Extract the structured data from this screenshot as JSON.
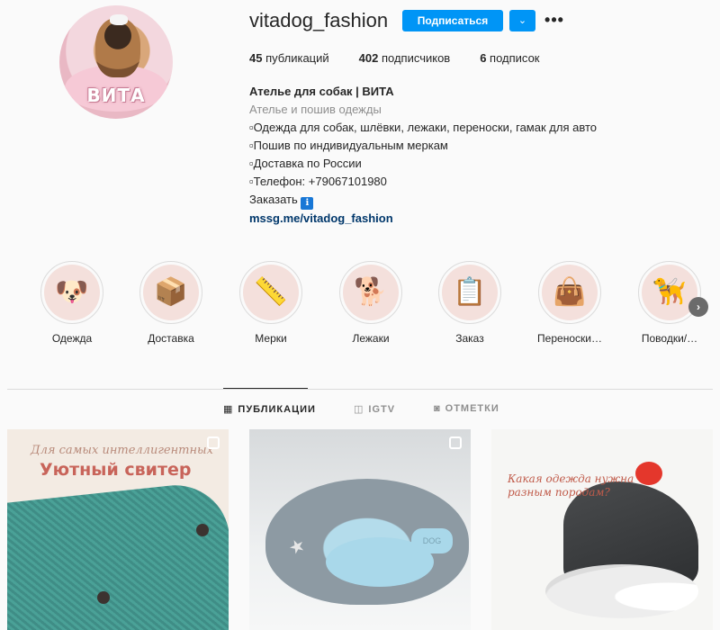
{
  "profile": {
    "avatar_text": "ВИТА",
    "username": "vitadog_fashion",
    "follow_label": "Подписаться",
    "dropdown_glyph": "⌄",
    "more_glyph": "•••",
    "stats": [
      {
        "value": "45",
        "label": " публикаций"
      },
      {
        "value": "402",
        "label": " подписчиков"
      },
      {
        "value": "6",
        "label": " подписок"
      }
    ],
    "bio": {
      "name": "Ателье для собак | ВИТА",
      "category": "Ателье и пошив одежды",
      "lines": [
        "▫Одежда для собак, шлёвки, лежаки, переноски, гамак для авто",
        "▫Пошив по индивидуальным меркам",
        "▫Доставка по России",
        "▫Телефон: +79067101980"
      ],
      "order_label": "Заказать",
      "order_icon": "ℹ",
      "link": "mssg.me/vitadog_fashion"
    }
  },
  "highlights": [
    {
      "label": "Одежда",
      "icon": "dog-face-icon",
      "glyph": "🐶"
    },
    {
      "label": "Доставка",
      "icon": "box-icon",
      "glyph": "📦"
    },
    {
      "label": "Мерки",
      "icon": "measuring-tape-icon",
      "glyph": "📏"
    },
    {
      "label": "Лежаки",
      "icon": "dog-bed-icon",
      "glyph": "🐕"
    },
    {
      "label": "Заказ",
      "icon": "order-document-icon",
      "glyph": "📋"
    },
    {
      "label": "Переноски…",
      "icon": "carrier-icon",
      "glyph": "👜"
    },
    {
      "label": "Поводки/…",
      "icon": "leash-icon",
      "glyph": "🦮"
    }
  ],
  "highlights_next": "›",
  "tabs": [
    {
      "label": "ПУБЛИКАЦИИ",
      "icon": "grid-icon",
      "glyph": "▦",
      "active": true
    },
    {
      "label": "IGTV",
      "icon": "igtv-icon",
      "glyph": "◫",
      "active": false
    },
    {
      "label": "ОТМЕТКИ",
      "icon": "tagged-icon",
      "glyph": "◙",
      "active": false
    }
  ],
  "posts": [
    {
      "top_text": "Для самых интеллигентных",
      "title": "Уютный свитер"
    },
    {
      "tag_text": "DOG"
    },
    {
      "text_line1": "Какая одежда нужна",
      "text_line2": "разным породам?"
    }
  ],
  "colors": {
    "accent": "#0095f6",
    "link": "#00376b",
    "muted": "#8e8e8e"
  }
}
